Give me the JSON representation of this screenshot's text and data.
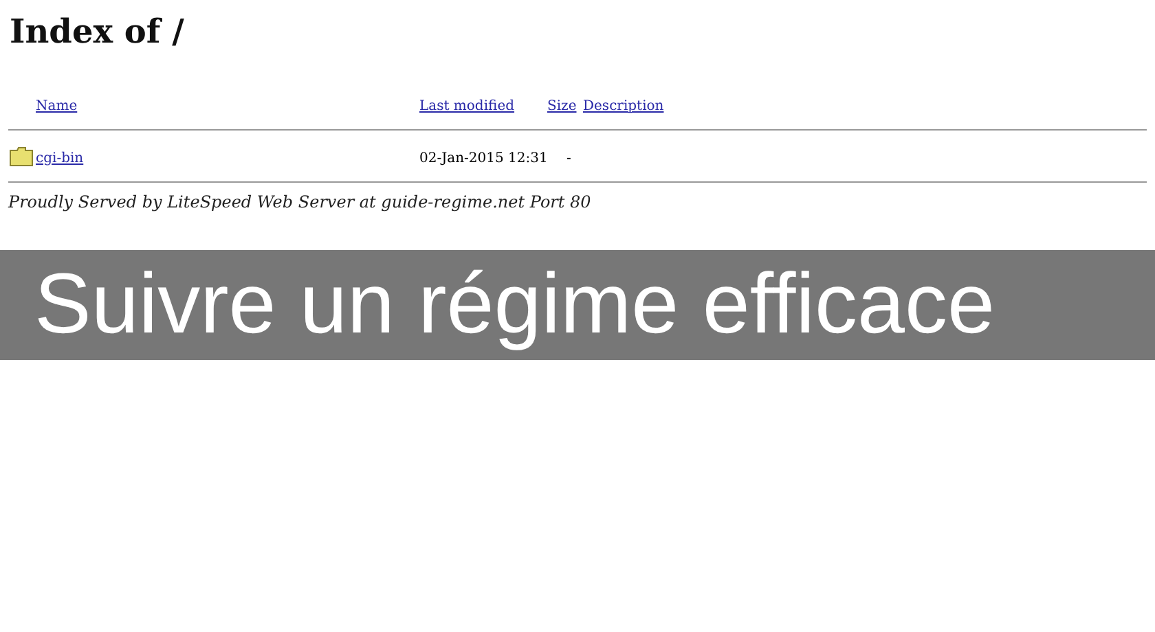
{
  "title": "Index of /",
  "table": {
    "columns": [
      "Name",
      "Last modified",
      "Size",
      "Description"
    ],
    "rows": [
      {
        "kind": "folder",
        "name": "cgi-bin",
        "modified": "02-Jan-2015 12:31",
        "size": "-"
      }
    ]
  },
  "footer": "Proudly Served by LiteSpeed Web Server at guide-regime.net Port 80",
  "banner": "Suivre un régime efficace"
}
